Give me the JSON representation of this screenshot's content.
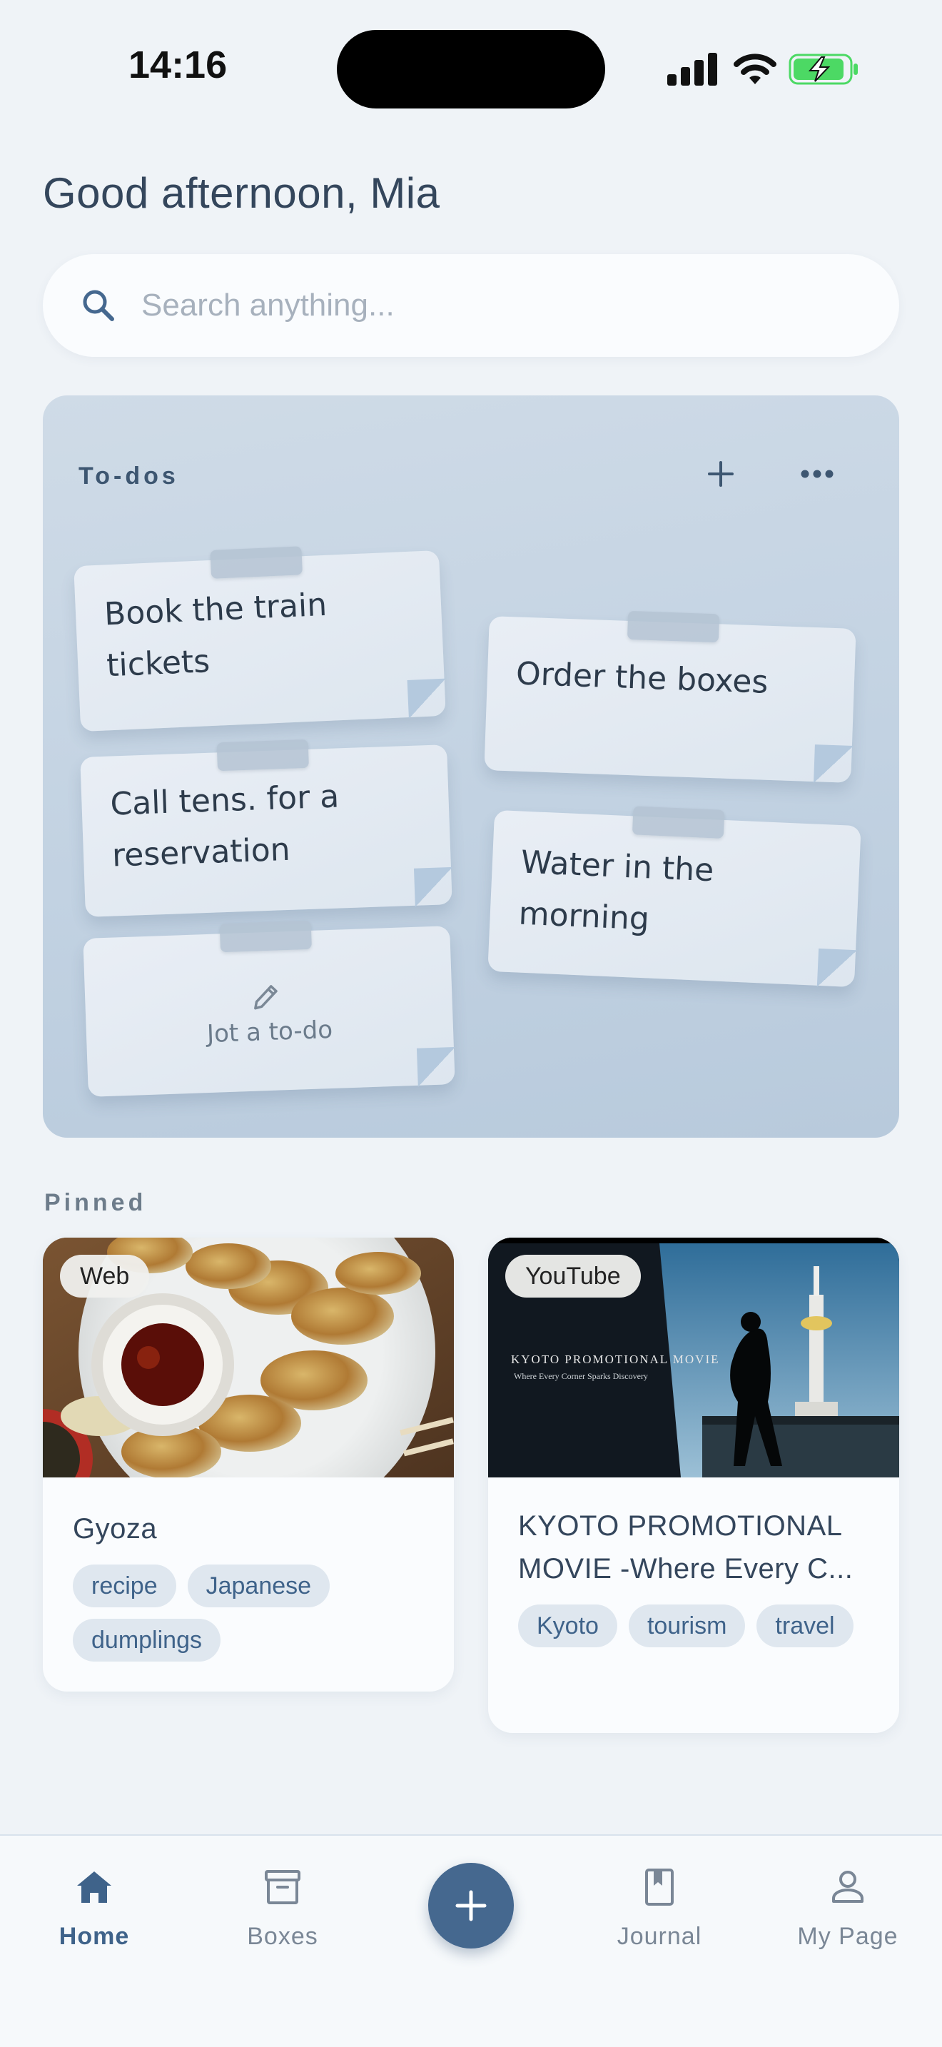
{
  "status_bar": {
    "time": "14:16"
  },
  "greeting": "Good afternoon, Mia",
  "search": {
    "placeholder": "Search anything..."
  },
  "todos": {
    "title": "To-dos",
    "add_icon": "plus-icon",
    "more_icon": "ellipsis-icon",
    "items": [
      {
        "text": "Book the train tickets"
      },
      {
        "text": "Order the boxes"
      },
      {
        "text": "Call tens. for a reservation"
      },
      {
        "text": "Water in the morning"
      }
    ],
    "new_item_label": "Jot a to-do"
  },
  "pinned": {
    "title": "Pinned",
    "cards": [
      {
        "source": "Web",
        "title": "Gyoza",
        "tags": [
          "recipe",
          "Japanese",
          "dumplings"
        ]
      },
      {
        "source": "YouTube",
        "thumbnail_text": "KYOTO PROMOTIONAL MOVIE",
        "thumbnail_subtext": "Where Every Corner Sparks Discovery",
        "title": "KYOTO PROMOTIONAL MOVIE -Where Every C...",
        "tags": [
          "Kyoto",
          "tourism",
          "travel"
        ]
      }
    ]
  },
  "nav": {
    "items": [
      {
        "label": "Home",
        "icon": "home-icon",
        "active": true
      },
      {
        "label": "Boxes",
        "icon": "archive-box-icon",
        "active": false
      },
      {
        "label": "Journal",
        "icon": "bookmark-book-icon",
        "active": false
      },
      {
        "label": "My Page",
        "icon": "person-icon",
        "active": false
      }
    ],
    "fab_icon": "plus-icon"
  },
  "colors": {
    "background": "#eff3f7",
    "accent": "#45688f",
    "tag_bg": "#dfe7ef",
    "tag_text": "#3f638a",
    "battery_charge": "#4cd964"
  }
}
